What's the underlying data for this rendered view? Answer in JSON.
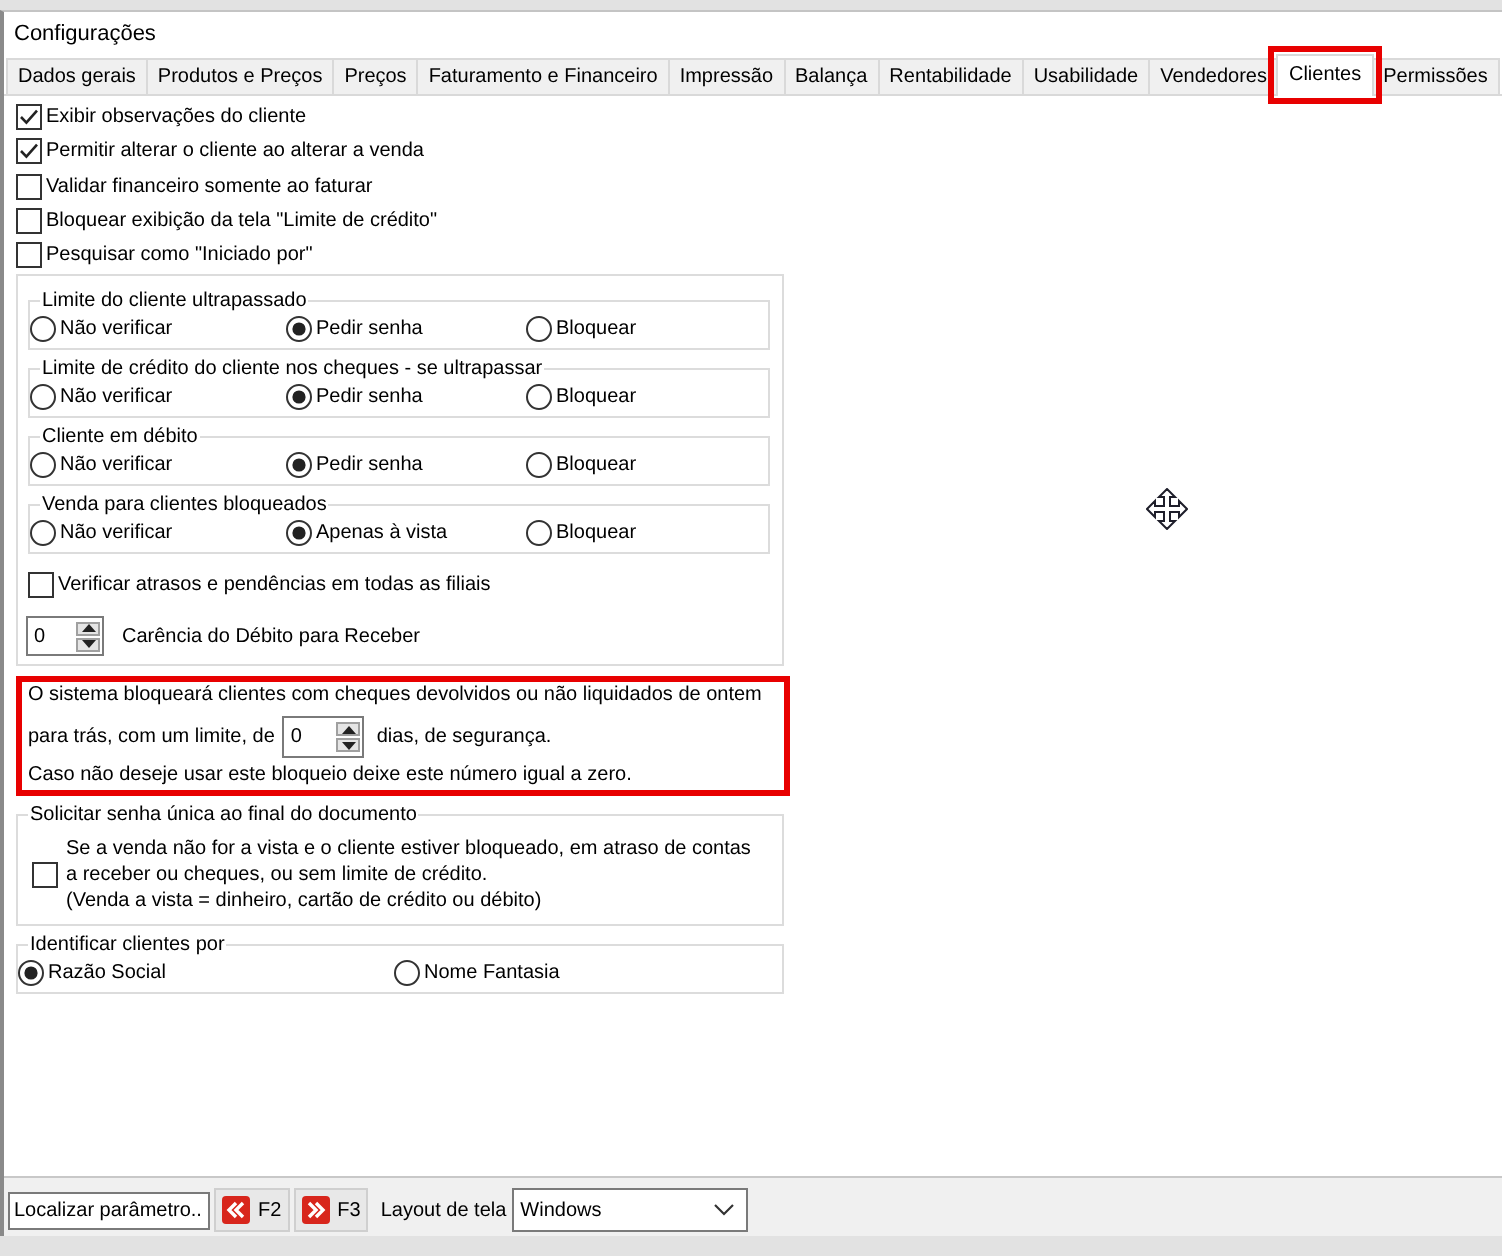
{
  "window": {
    "title": "Configurações"
  },
  "tabs": [
    {
      "label": "Dados gerais",
      "selected": false,
      "highlighted": false
    },
    {
      "label": "Produtos e Preços",
      "selected": false,
      "highlighted": false
    },
    {
      "label": "Preços",
      "selected": false,
      "highlighted": false
    },
    {
      "label": "Faturamento e Financeiro",
      "selected": false,
      "highlighted": false
    },
    {
      "label": "Impressão",
      "selected": false,
      "highlighted": false
    },
    {
      "label": "Balança",
      "selected": false,
      "highlighted": false
    },
    {
      "label": "Rentabilidade",
      "selected": false,
      "highlighted": false
    },
    {
      "label": "Usabilidade",
      "selected": false,
      "highlighted": false
    },
    {
      "label": "Vendedores",
      "selected": false,
      "highlighted": false
    },
    {
      "label": "Clientes",
      "selected": true,
      "highlighted": true
    },
    {
      "label": "Permissões",
      "selected": false,
      "highlighted": false
    }
  ],
  "options": [
    {
      "label": "Exibir observações do cliente",
      "checked": true
    },
    {
      "label": "Permitir alterar o cliente ao alterar a venda",
      "checked": true
    },
    {
      "label": "Validar financeiro somente ao faturar",
      "checked": false
    },
    {
      "label": "Bloquear exibição da tela \"Limite de crédito\"",
      "checked": false
    },
    {
      "label": "Pesquisar como \"Iniciado por\"",
      "checked": false
    }
  ],
  "rules_panel": {
    "radio_groups": [
      {
        "title": "Limite do cliente ultrapassado",
        "options": [
          {
            "label": "Não verificar",
            "selected": false
          },
          {
            "label": "Pedir senha",
            "selected": true
          },
          {
            "label": "Bloquear",
            "selected": false
          }
        ]
      },
      {
        "title": "Limite de crédito do cliente nos cheques - se ultrapassar",
        "options": [
          {
            "label": "Não verificar",
            "selected": false
          },
          {
            "label": "Pedir senha",
            "selected": true
          },
          {
            "label": "Bloquear",
            "selected": false
          }
        ]
      },
      {
        "title": "Cliente em débito",
        "options": [
          {
            "label": "Não verificar",
            "selected": false
          },
          {
            "label": "Pedir senha",
            "selected": true
          },
          {
            "label": "Bloquear",
            "selected": false
          }
        ]
      },
      {
        "title": "Venda para clientes bloqueados",
        "options": [
          {
            "label": "Não verificar",
            "selected": false
          },
          {
            "label": "Apenas à vista",
            "selected": true
          },
          {
            "label": "Bloquear",
            "selected": false
          }
        ]
      }
    ],
    "all_branches": {
      "label": "Verificar atrasos e pendências em todas as filiais",
      "checked": false
    },
    "grace_period": {
      "value": "0",
      "label": "Carência do Débito para Receber"
    }
  },
  "cheque_notice": {
    "highlighted": true,
    "line_1": "O sistema bloqueará clientes com cheques devolvidos ou não liquidados de ontem",
    "before_field": "para trás, com um limite, de",
    "value": "0",
    "after_field": "dias, de segurança.",
    "line_3": "Caso não deseje usar este bloqueio deixe este número igual a zero."
  },
  "single_password": {
    "title": "Solicitar senha única ao final do documento",
    "checked": false,
    "label": "Se a venda não for a vista e o cliente estiver bloqueado, em atraso de contas\na receber ou cheques, ou sem limite de crédito.\n(Venda a vista = dinheiro, cartão de crédito ou débito)"
  },
  "identify_by": {
    "title": "Identificar clientes por",
    "options": [
      {
        "label": "Razão Social",
        "selected": true
      },
      {
        "label": "Nome Fantasia",
        "selected": false
      }
    ]
  },
  "toolbar": {
    "search_value": "Localizar parâmetro..",
    "prev_key": "F2",
    "next_key": "F3",
    "layout_label": "Layout de tela",
    "layout_value": "Windows"
  }
}
